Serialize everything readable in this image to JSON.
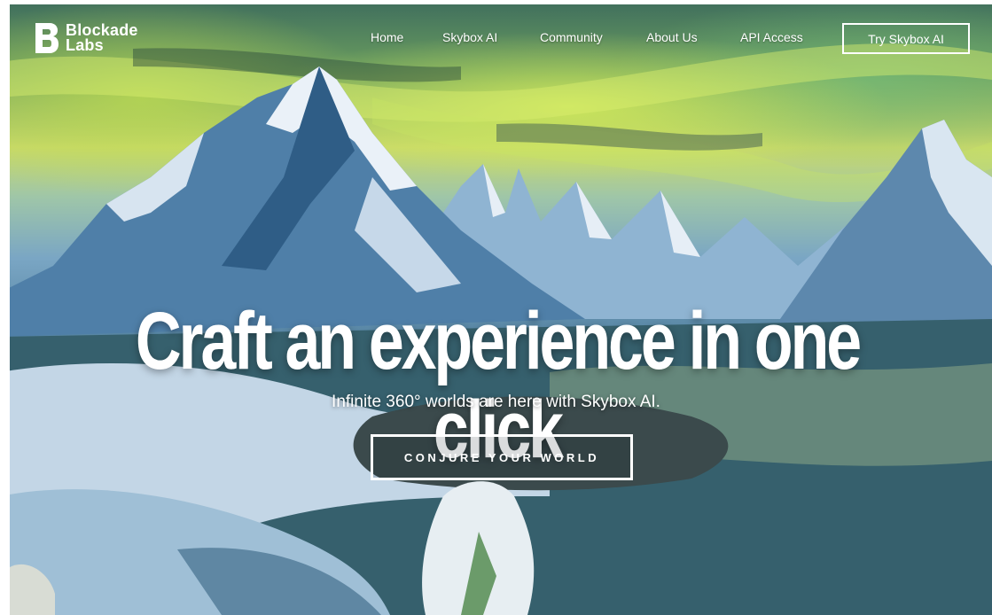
{
  "brand": {
    "line1": "Blockade",
    "line2": "Labs",
    "icon": "blockade-labs-logo-mark",
    "color": "#ffffff"
  },
  "nav": {
    "links": [
      {
        "label": "Home"
      },
      {
        "label": "Skybox AI"
      },
      {
        "label": "Community"
      },
      {
        "label": "About Us"
      },
      {
        "label": "API Access"
      }
    ],
    "cta_label": "Try Skybox AI"
  },
  "hero": {
    "headline": "Craft an experience in one click",
    "subhead": "Infinite 360° worlds are here with Skybox AI.",
    "cta_label": "CONJURE YOUR WORLD",
    "background": "aurora-over-icy-mountains",
    "colors": {
      "aurora": "#c9d96a",
      "ice": "#dbe7f2",
      "water": "#2c4f5e"
    }
  }
}
